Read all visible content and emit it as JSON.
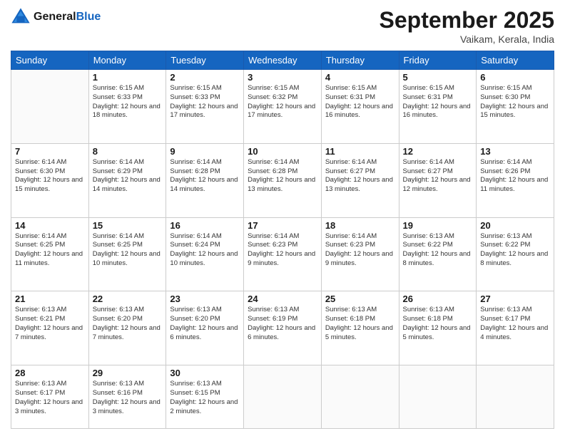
{
  "logo": {
    "line1": "General",
    "line2": "Blue"
  },
  "title": "September 2025",
  "location": "Vaikam, Kerala, India",
  "days_header": [
    "Sunday",
    "Monday",
    "Tuesday",
    "Wednesday",
    "Thursday",
    "Friday",
    "Saturday"
  ],
  "weeks": [
    [
      {
        "day": "",
        "sunrise": "",
        "sunset": "",
        "daylight": ""
      },
      {
        "day": "1",
        "sunrise": "Sunrise: 6:15 AM",
        "sunset": "Sunset: 6:33 PM",
        "daylight": "Daylight: 12 hours and 18 minutes."
      },
      {
        "day": "2",
        "sunrise": "Sunrise: 6:15 AM",
        "sunset": "Sunset: 6:33 PM",
        "daylight": "Daylight: 12 hours and 17 minutes."
      },
      {
        "day": "3",
        "sunrise": "Sunrise: 6:15 AM",
        "sunset": "Sunset: 6:32 PM",
        "daylight": "Daylight: 12 hours and 17 minutes."
      },
      {
        "day": "4",
        "sunrise": "Sunrise: 6:15 AM",
        "sunset": "Sunset: 6:31 PM",
        "daylight": "Daylight: 12 hours and 16 minutes."
      },
      {
        "day": "5",
        "sunrise": "Sunrise: 6:15 AM",
        "sunset": "Sunset: 6:31 PM",
        "daylight": "Daylight: 12 hours and 16 minutes."
      },
      {
        "day": "6",
        "sunrise": "Sunrise: 6:15 AM",
        "sunset": "Sunset: 6:30 PM",
        "daylight": "Daylight: 12 hours and 15 minutes."
      }
    ],
    [
      {
        "day": "7",
        "sunrise": "Sunrise: 6:14 AM",
        "sunset": "Sunset: 6:30 PM",
        "daylight": "Daylight: 12 hours and 15 minutes."
      },
      {
        "day": "8",
        "sunrise": "Sunrise: 6:14 AM",
        "sunset": "Sunset: 6:29 PM",
        "daylight": "Daylight: 12 hours and 14 minutes."
      },
      {
        "day": "9",
        "sunrise": "Sunrise: 6:14 AM",
        "sunset": "Sunset: 6:28 PM",
        "daylight": "Daylight: 12 hours and 14 minutes."
      },
      {
        "day": "10",
        "sunrise": "Sunrise: 6:14 AM",
        "sunset": "Sunset: 6:28 PM",
        "daylight": "Daylight: 12 hours and 13 minutes."
      },
      {
        "day": "11",
        "sunrise": "Sunrise: 6:14 AM",
        "sunset": "Sunset: 6:27 PM",
        "daylight": "Daylight: 12 hours and 13 minutes."
      },
      {
        "day": "12",
        "sunrise": "Sunrise: 6:14 AM",
        "sunset": "Sunset: 6:27 PM",
        "daylight": "Daylight: 12 hours and 12 minutes."
      },
      {
        "day": "13",
        "sunrise": "Sunrise: 6:14 AM",
        "sunset": "Sunset: 6:26 PM",
        "daylight": "Daylight: 12 hours and 11 minutes."
      }
    ],
    [
      {
        "day": "14",
        "sunrise": "Sunrise: 6:14 AM",
        "sunset": "Sunset: 6:25 PM",
        "daylight": "Daylight: 12 hours and 11 minutes."
      },
      {
        "day": "15",
        "sunrise": "Sunrise: 6:14 AM",
        "sunset": "Sunset: 6:25 PM",
        "daylight": "Daylight: 12 hours and 10 minutes."
      },
      {
        "day": "16",
        "sunrise": "Sunrise: 6:14 AM",
        "sunset": "Sunset: 6:24 PM",
        "daylight": "Daylight: 12 hours and 10 minutes."
      },
      {
        "day": "17",
        "sunrise": "Sunrise: 6:14 AM",
        "sunset": "Sunset: 6:23 PM",
        "daylight": "Daylight: 12 hours and 9 minutes."
      },
      {
        "day": "18",
        "sunrise": "Sunrise: 6:14 AM",
        "sunset": "Sunset: 6:23 PM",
        "daylight": "Daylight: 12 hours and 9 minutes."
      },
      {
        "day": "19",
        "sunrise": "Sunrise: 6:13 AM",
        "sunset": "Sunset: 6:22 PM",
        "daylight": "Daylight: 12 hours and 8 minutes."
      },
      {
        "day": "20",
        "sunrise": "Sunrise: 6:13 AM",
        "sunset": "Sunset: 6:22 PM",
        "daylight": "Daylight: 12 hours and 8 minutes."
      }
    ],
    [
      {
        "day": "21",
        "sunrise": "Sunrise: 6:13 AM",
        "sunset": "Sunset: 6:21 PM",
        "daylight": "Daylight: 12 hours and 7 minutes."
      },
      {
        "day": "22",
        "sunrise": "Sunrise: 6:13 AM",
        "sunset": "Sunset: 6:20 PM",
        "daylight": "Daylight: 12 hours and 7 minutes."
      },
      {
        "day": "23",
        "sunrise": "Sunrise: 6:13 AM",
        "sunset": "Sunset: 6:20 PM",
        "daylight": "Daylight: 12 hours and 6 minutes."
      },
      {
        "day": "24",
        "sunrise": "Sunrise: 6:13 AM",
        "sunset": "Sunset: 6:19 PM",
        "daylight": "Daylight: 12 hours and 6 minutes."
      },
      {
        "day": "25",
        "sunrise": "Sunrise: 6:13 AM",
        "sunset": "Sunset: 6:18 PM",
        "daylight": "Daylight: 12 hours and 5 minutes."
      },
      {
        "day": "26",
        "sunrise": "Sunrise: 6:13 AM",
        "sunset": "Sunset: 6:18 PM",
        "daylight": "Daylight: 12 hours and 5 minutes."
      },
      {
        "day": "27",
        "sunrise": "Sunrise: 6:13 AM",
        "sunset": "Sunset: 6:17 PM",
        "daylight": "Daylight: 12 hours and 4 minutes."
      }
    ],
    [
      {
        "day": "28",
        "sunrise": "Sunrise: 6:13 AM",
        "sunset": "Sunset: 6:17 PM",
        "daylight": "Daylight: 12 hours and 3 minutes."
      },
      {
        "day": "29",
        "sunrise": "Sunrise: 6:13 AM",
        "sunset": "Sunset: 6:16 PM",
        "daylight": "Daylight: 12 hours and 3 minutes."
      },
      {
        "day": "30",
        "sunrise": "Sunrise: 6:13 AM",
        "sunset": "Sunset: 6:15 PM",
        "daylight": "Daylight: 12 hours and 2 minutes."
      },
      {
        "day": "",
        "sunrise": "",
        "sunset": "",
        "daylight": ""
      },
      {
        "day": "",
        "sunrise": "",
        "sunset": "",
        "daylight": ""
      },
      {
        "day": "",
        "sunrise": "",
        "sunset": "",
        "daylight": ""
      },
      {
        "day": "",
        "sunrise": "",
        "sunset": "",
        "daylight": ""
      }
    ]
  ]
}
